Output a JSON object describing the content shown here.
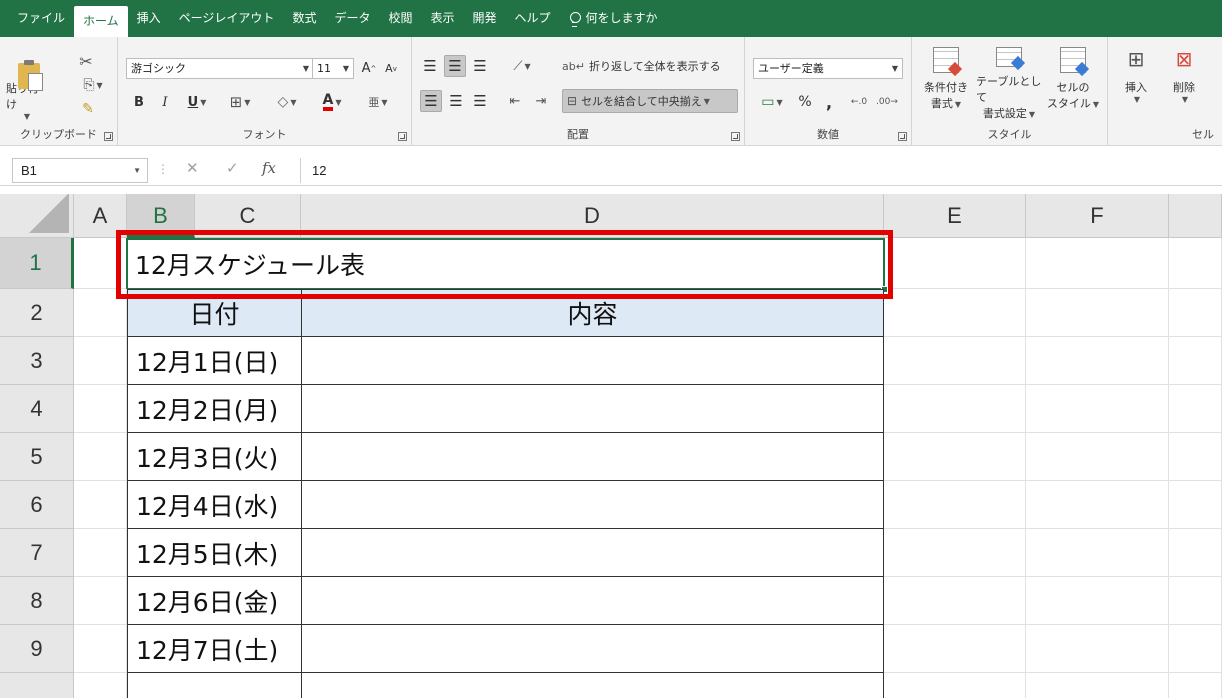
{
  "tabs": [
    "ファイル",
    "ホーム",
    "挿入",
    "ページレイアウト",
    "数式",
    "データ",
    "校閲",
    "表示",
    "開発",
    "ヘルプ"
  ],
  "active_tab": "ホーム",
  "tell_me": "何をしますか",
  "ribbon": {
    "clipboard": {
      "label": "クリップボード",
      "paste": "貼り付け"
    },
    "font": {
      "label": "フォント",
      "family": "游ゴシック",
      "size": "11",
      "grow": "A",
      "shrink": "A",
      "bold": "B",
      "italic": "I",
      "underline": "U",
      "font_color_letter": "A"
    },
    "alignment": {
      "label": "配置",
      "wrap": "折り返して全体を表示する",
      "merge": "セルを結合して中央揃え"
    },
    "number": {
      "label": "数値",
      "format": "ユーザー定義",
      "percent": "%",
      "comma": ","
    },
    "styles": {
      "label": "スタイル",
      "conditional": [
        "条件付き",
        "書式"
      ],
      "table": [
        "テーブルとして",
        "書式設定"
      ],
      "cell_styles": [
        "セルの",
        "スタイル"
      ]
    },
    "cells": {
      "label": "セル",
      "insert": "挿入",
      "delete": "削除"
    }
  },
  "formula_bar": {
    "name_box": "B1",
    "fx": "fx",
    "value": "12"
  },
  "columns": [
    "A",
    "B",
    "C",
    "D",
    "E",
    "F"
  ],
  "rows": [
    "1",
    "2",
    "3",
    "4",
    "5",
    "6",
    "7",
    "8",
    "9"
  ],
  "sheet": {
    "title": "12月スケジュール表",
    "header_date": "日付",
    "header_content": "内容",
    "dates": [
      "12月1日(日)",
      "12月2日(月)",
      "12月3日(火)",
      "12月4日(水)",
      "12月5日(木)",
      "12月6日(金)",
      "12月7日(土)"
    ]
  },
  "colors": {
    "excel_green": "#217346",
    "highlight": "#e30000",
    "header_fill": "#dde9f5"
  }
}
